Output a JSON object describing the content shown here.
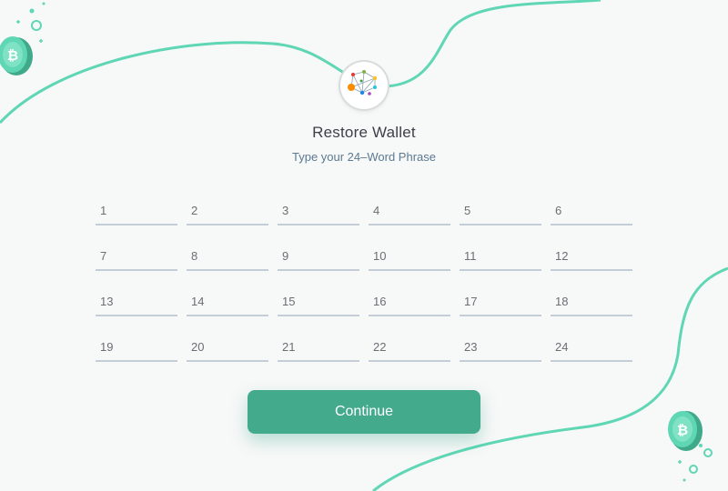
{
  "header": {
    "title": "Restore Wallet",
    "subtitle": "Type your 24–Word Phrase"
  },
  "words": [
    {
      "num": "1",
      "value": ""
    },
    {
      "num": "2",
      "value": ""
    },
    {
      "num": "3",
      "value": ""
    },
    {
      "num": "4",
      "value": ""
    },
    {
      "num": "5",
      "value": ""
    },
    {
      "num": "6",
      "value": ""
    },
    {
      "num": "7",
      "value": ""
    },
    {
      "num": "8",
      "value": ""
    },
    {
      "num": "9",
      "value": ""
    },
    {
      "num": "10",
      "value": ""
    },
    {
      "num": "11",
      "value": ""
    },
    {
      "num": "12",
      "value": ""
    },
    {
      "num": "13",
      "value": ""
    },
    {
      "num": "14",
      "value": ""
    },
    {
      "num": "15",
      "value": ""
    },
    {
      "num": "16",
      "value": ""
    },
    {
      "num": "17",
      "value": ""
    },
    {
      "num": "18",
      "value": ""
    },
    {
      "num": "19",
      "value": ""
    },
    {
      "num": "20",
      "value": ""
    },
    {
      "num": "21",
      "value": ""
    },
    {
      "num": "22",
      "value": ""
    },
    {
      "num": "23",
      "value": ""
    },
    {
      "num": "24",
      "value": ""
    }
  ],
  "actions": {
    "continue_label": "Continue"
  },
  "colors": {
    "accent": "#43aa8b",
    "curve": "#5fd6b4",
    "field_underline": "#c5cdd6"
  },
  "icons": {
    "logo": "network-graph-logo-icon",
    "coin": "bitcoin-coin-icon"
  }
}
